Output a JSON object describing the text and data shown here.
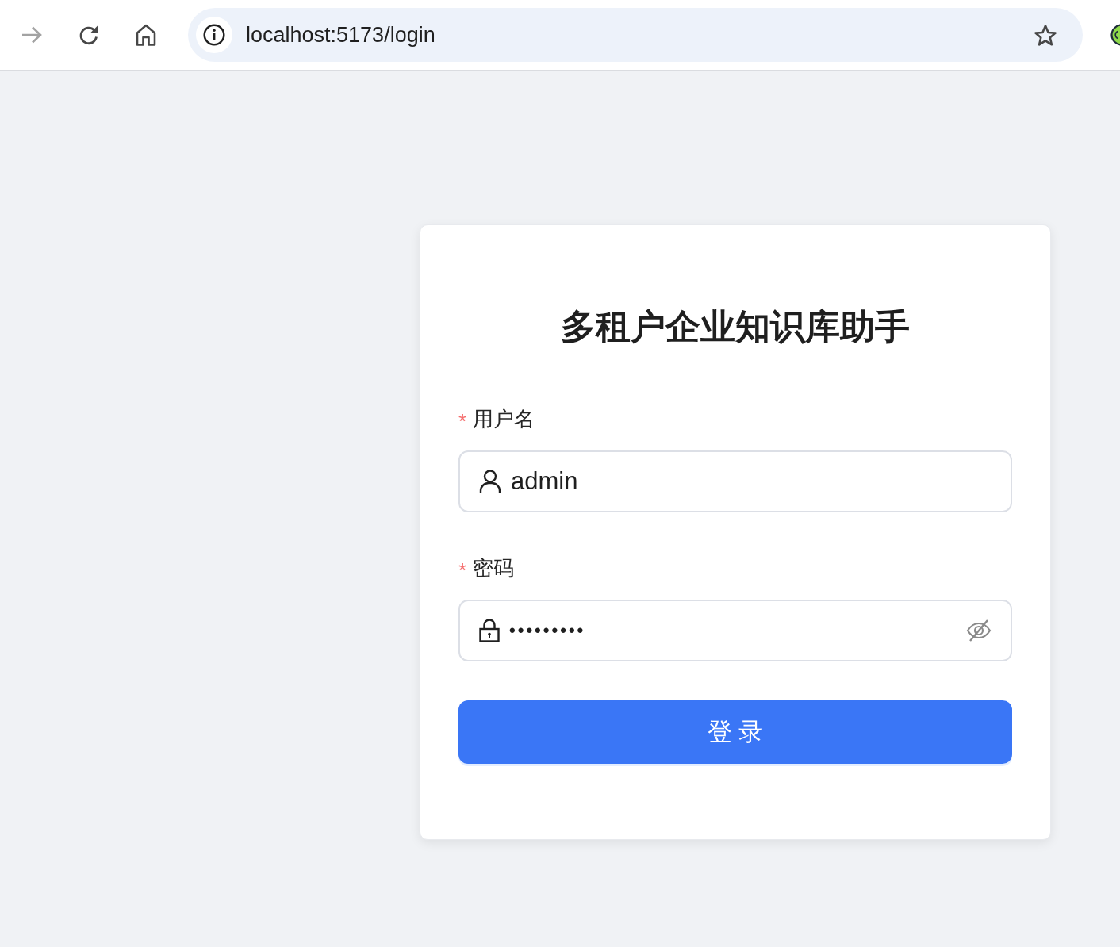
{
  "browser": {
    "forward_disabled": true,
    "url": "localhost:5173/login"
  },
  "login_card": {
    "title": "多租户企业知识库助手",
    "fields": [
      {
        "kind": "text",
        "required_mark": "*",
        "label": "用户名",
        "value": "admin"
      },
      {
        "kind": "password",
        "required_mark": "*",
        "label": "密码",
        "value": "•••••••••"
      }
    ],
    "submit_button": "登 录"
  }
}
